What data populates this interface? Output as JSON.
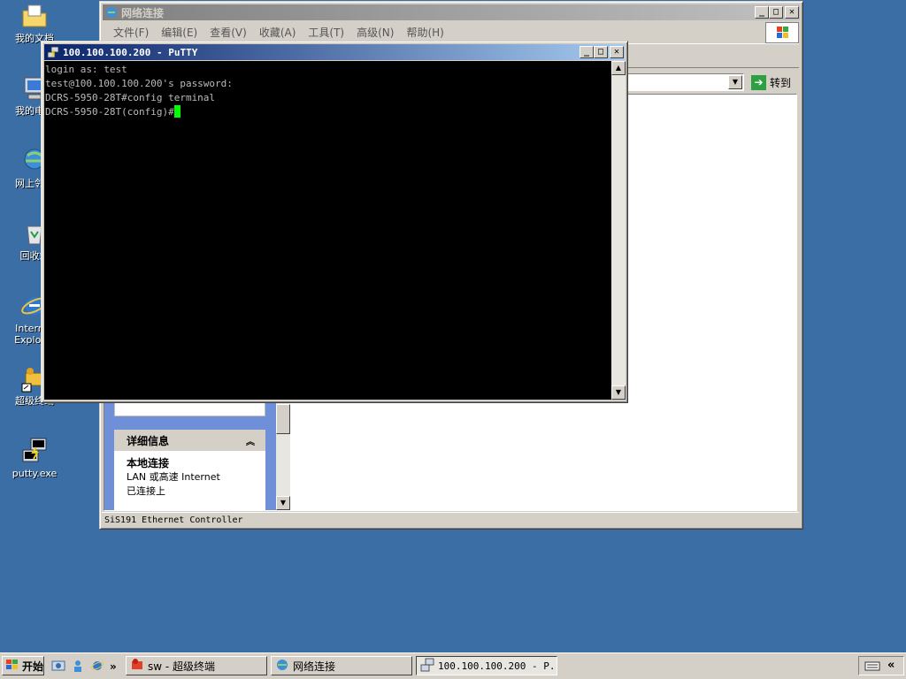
{
  "desktop": {
    "icons": [
      {
        "label": "我的文档",
        "icon": "folder-documents-icon"
      },
      {
        "label": "我的电脑",
        "icon": "computer-icon"
      },
      {
        "label": "网上邻居",
        "icon": "network-places-icon"
      },
      {
        "label": "回收站",
        "icon": "recycle-bin-icon"
      },
      {
        "label": "Internet Explorer",
        "icon": "ie-icon"
      },
      {
        "label": "超级终端",
        "icon": "hyperterminal-icon"
      },
      {
        "label": "putty.exe",
        "icon": "putty-icon"
      }
    ]
  },
  "network_window": {
    "title": "网络连接",
    "menu": [
      "文件(F)",
      "编辑(E)",
      "查看(V)",
      "收藏(A)",
      "工具(T)",
      "高级(N)",
      "帮助(H)"
    ],
    "go_button": "转到",
    "details_panel": {
      "header": "详细信息",
      "name": "本地连接",
      "type": "LAN 或高速 Internet",
      "status": "已连接上"
    },
    "statusbar": "SiS191 Ethernet Controller"
  },
  "putty_window": {
    "title": "100.100.100.200 - PuTTY",
    "lines": [
      "login as: test",
      "test@100.100.100.200's password:",
      "DCRS-5950-28T#config terminal",
      "DCRS-5950-28T(config)#"
    ]
  },
  "taskbar": {
    "start_label": "开始",
    "quicklaunch_more": "»",
    "tasks": [
      {
        "label": "sw - 超级终端",
        "active": false
      },
      {
        "label": "网络连接",
        "active": false
      },
      {
        "label": "100.100.100.200 - P...",
        "active": true
      }
    ],
    "tray_chevron": "«"
  },
  "colors": {
    "desktop": "#3a6ea5",
    "title_active": "#0a246a",
    "title_inactive": "#808080",
    "cursor": "#00ff00"
  }
}
